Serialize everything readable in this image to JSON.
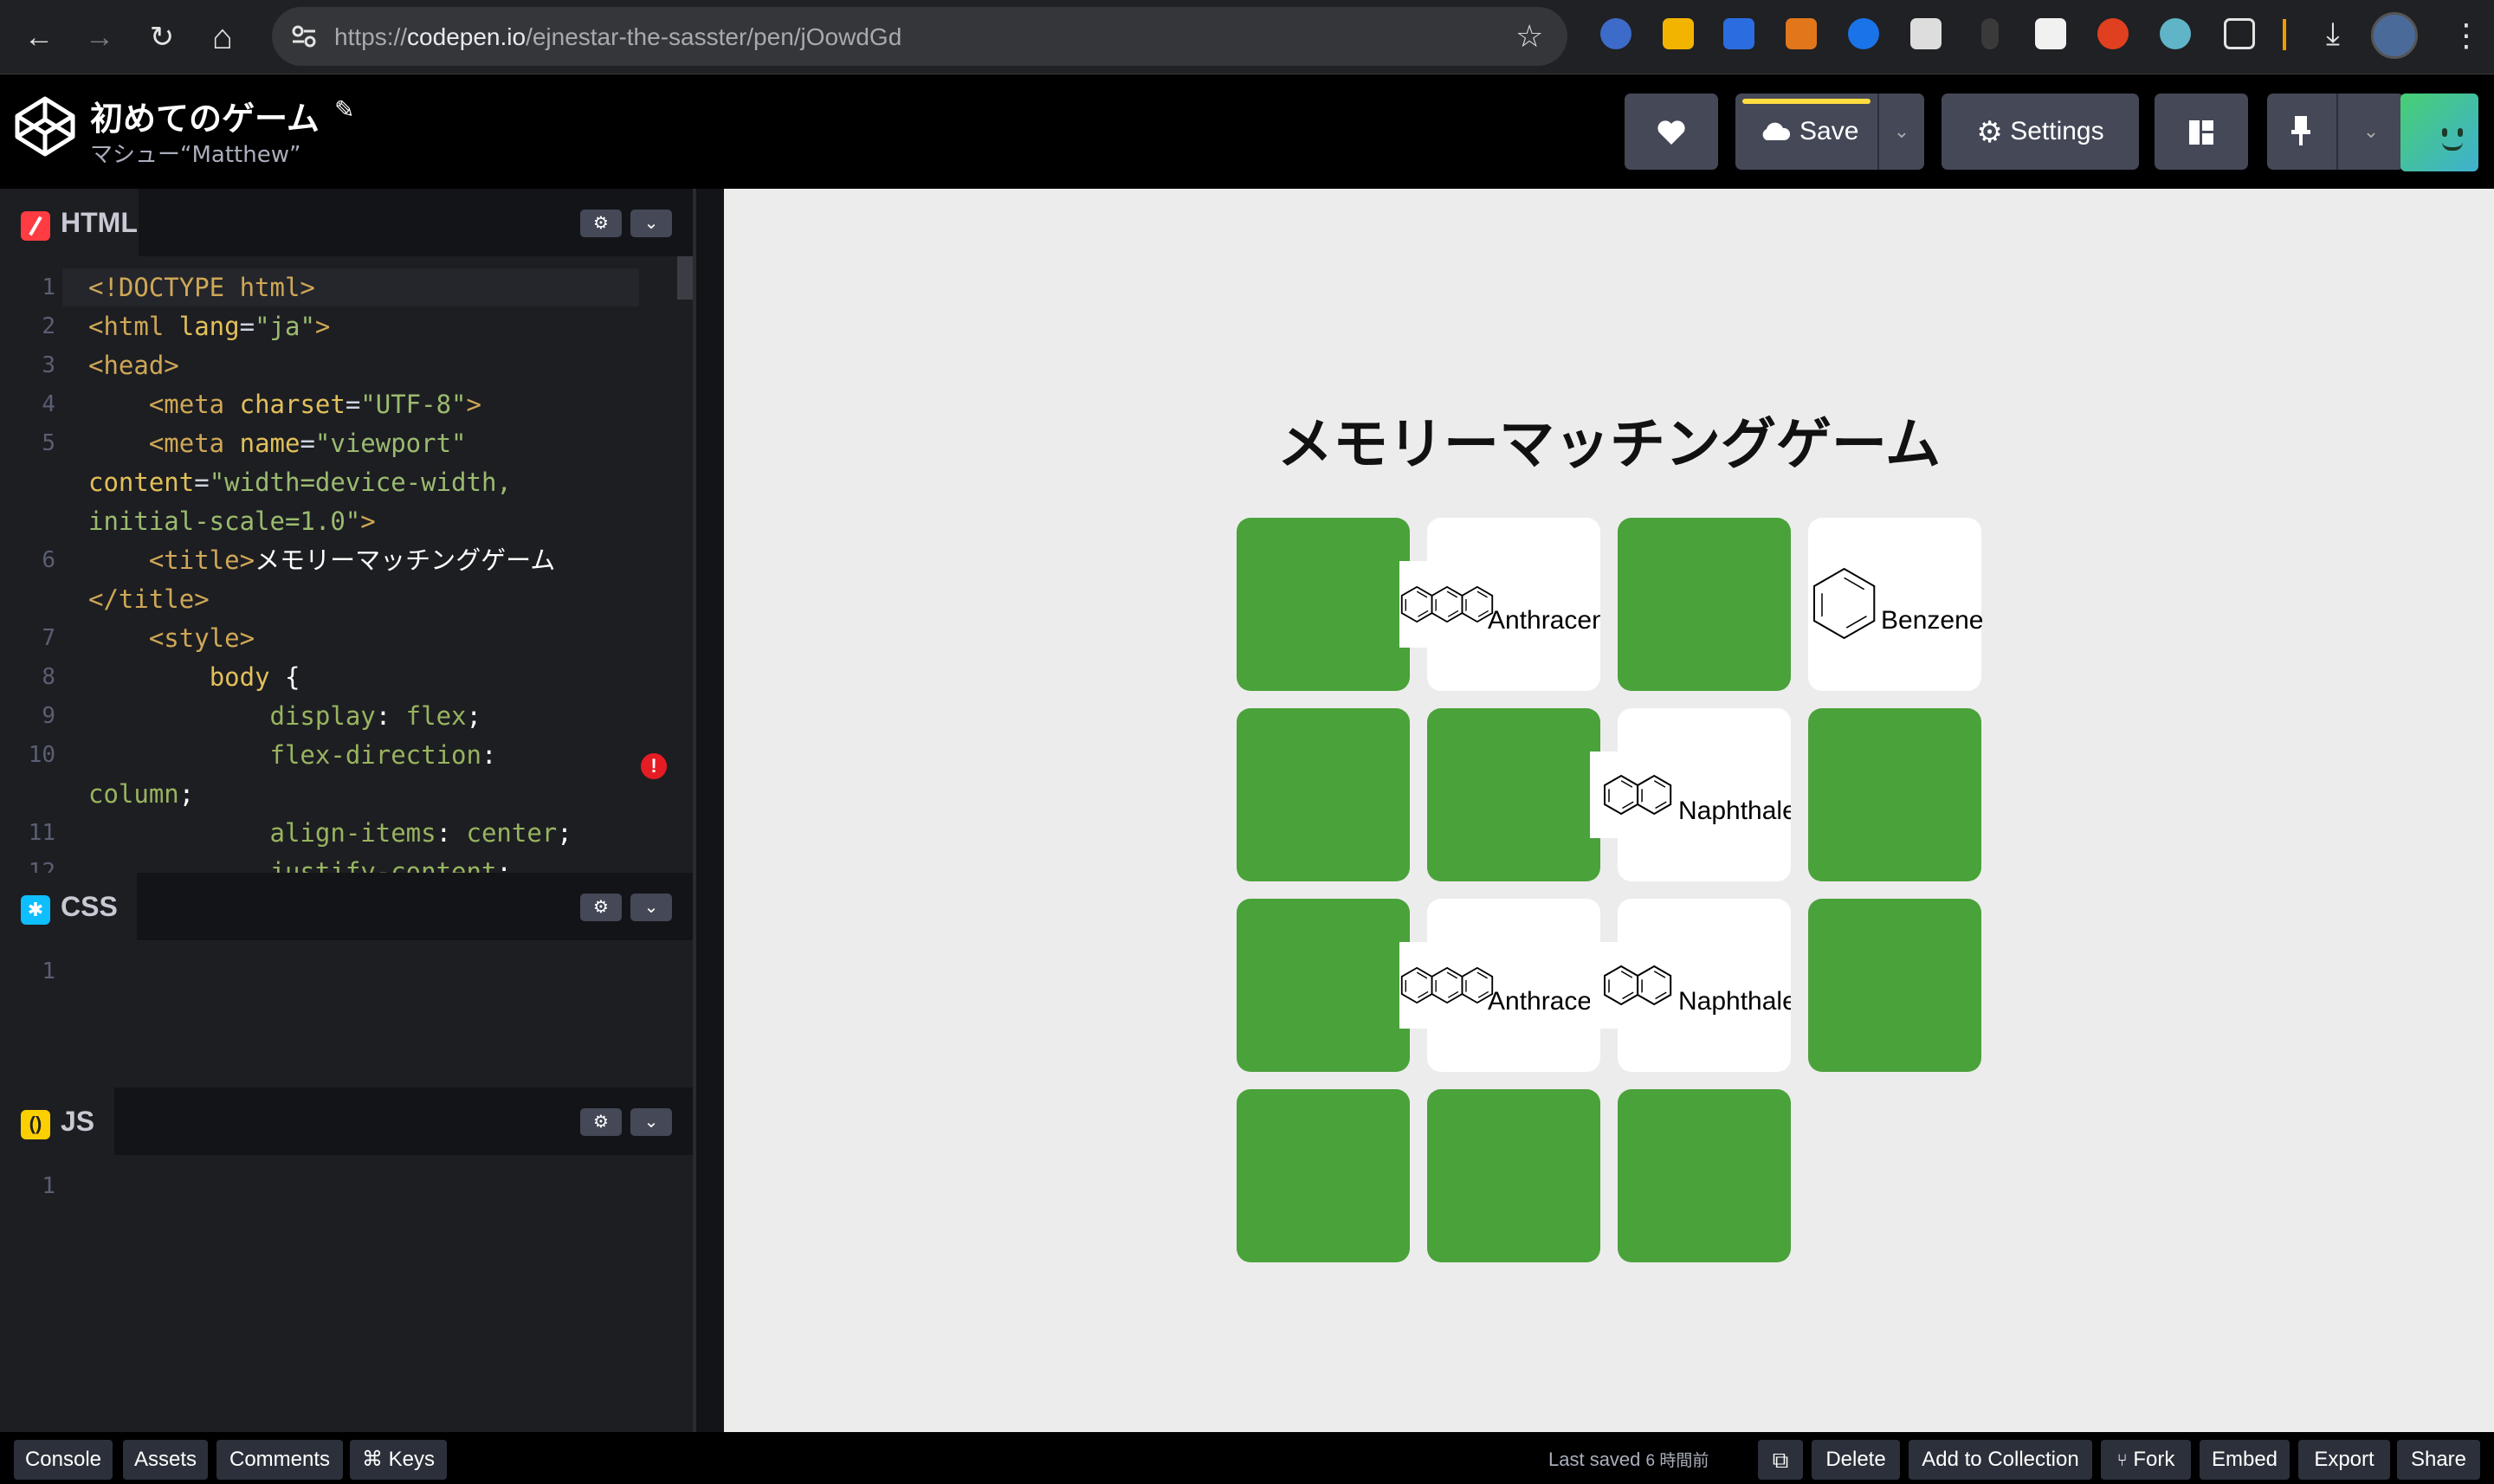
{
  "browser": {
    "url_prefix": "https://",
    "url_host": "codepen.io",
    "url_path": "/ejnestar-the-sasster/pen/jOowdGd",
    "nav": {
      "back": "←",
      "forward": "→",
      "reload": "↻",
      "home": "⌂"
    }
  },
  "header": {
    "pen_title": "初めてのゲーム",
    "author": "マシュー“Matthew”",
    "save_label": "Save",
    "settings_label": "Settings"
  },
  "editors": {
    "html": {
      "label": "HTML",
      "line_numbers": [
        "1",
        "2",
        "3",
        "4",
        "5",
        "",
        "",
        "6",
        "",
        "7",
        "8",
        "9",
        "10",
        "",
        "11",
        "12"
      ],
      "lines": [
        [
          {
            "c": "tg",
            "t": "<!DOCTYPE html>"
          }
        ],
        [
          {
            "c": "tg",
            "t": "<html "
          },
          {
            "c": "at",
            "t": "lang"
          },
          {
            "c": "pl",
            "t": "="
          },
          {
            "c": "sv",
            "t": "\"ja\""
          },
          {
            "c": "tg",
            "t": ">"
          }
        ],
        [
          {
            "c": "tg",
            "t": "<head>"
          }
        ],
        [
          {
            "c": "pl",
            "t": "    "
          },
          {
            "c": "tg",
            "t": "<meta "
          },
          {
            "c": "at",
            "t": "charset"
          },
          {
            "c": "pl",
            "t": "="
          },
          {
            "c": "sv",
            "t": "\"UTF-8\""
          },
          {
            "c": "tg",
            "t": ">"
          }
        ],
        [
          {
            "c": "pl",
            "t": "    "
          },
          {
            "c": "tg",
            "t": "<meta "
          },
          {
            "c": "at",
            "t": "name"
          },
          {
            "c": "pl",
            "t": "="
          },
          {
            "c": "sv",
            "t": "\"viewport\""
          }
        ],
        [
          {
            "c": "at",
            "t": "content"
          },
          {
            "c": "pl",
            "t": "="
          },
          {
            "c": "sv",
            "t": "\"width=device-width,"
          }
        ],
        [
          {
            "c": "sv",
            "t": "initial-scale=1.0\""
          },
          {
            "c": "tg",
            "t": ">"
          }
        ],
        [
          {
            "c": "pl",
            "t": "    "
          },
          {
            "c": "tg",
            "t": "<title>"
          },
          {
            "c": "wt",
            "t": "メモリーマッチングゲーム"
          }
        ],
        [
          {
            "c": "tg",
            "t": "</title>"
          }
        ],
        [
          {
            "c": "pl",
            "t": "    "
          },
          {
            "c": "tg",
            "t": "<style>"
          }
        ],
        [
          {
            "c": "pl",
            "t": "        "
          },
          {
            "c": "at",
            "t": "body "
          },
          {
            "c": "wt",
            "t": "{"
          }
        ],
        [
          {
            "c": "pl",
            "t": "            "
          },
          {
            "c": "pr",
            "t": "display"
          },
          {
            "c": "wt",
            "t": ": "
          },
          {
            "c": "pr",
            "t": "flex"
          },
          {
            "c": "wt",
            "t": ";"
          }
        ],
        [
          {
            "c": "pl",
            "t": "            "
          },
          {
            "c": "pr",
            "t": "flex-direction"
          },
          {
            "c": "wt",
            "t": ":"
          }
        ],
        [
          {
            "c": "pr",
            "t": "column"
          },
          {
            "c": "wt",
            "t": ";"
          }
        ],
        [
          {
            "c": "pl",
            "t": "            "
          },
          {
            "c": "pr",
            "t": "align-items"
          },
          {
            "c": "wt",
            "t": ": "
          },
          {
            "c": "pr",
            "t": "center"
          },
          {
            "c": "wt",
            "t": ";"
          }
        ],
        [
          {
            "c": "pl",
            "t": "            "
          },
          {
            "c": "pr",
            "t": "justify-content"
          },
          {
            "c": "wt",
            "t": ":"
          }
        ]
      ]
    },
    "css": {
      "label": "CSS",
      "line_number": "1"
    },
    "js": {
      "label": "JS",
      "line_number": "1"
    }
  },
  "preview": {
    "title": "メモリーマッチングゲーム",
    "cards": [
      {
        "state": "down",
        "label": "",
        "icon": ""
      },
      {
        "state": "up",
        "label": "Anthracene",
        "icon": "anthracene-icon"
      },
      {
        "state": "down",
        "label": "",
        "icon": ""
      },
      {
        "state": "up",
        "label": "Benzene",
        "icon": "benzene-icon"
      },
      {
        "state": "down",
        "label": "",
        "icon": ""
      },
      {
        "state": "down",
        "label": "",
        "icon": ""
      },
      {
        "state": "up",
        "label": "Naphthalene",
        "icon": "naphthalene-icon"
      },
      {
        "state": "down",
        "label": "",
        "icon": ""
      },
      {
        "state": "down",
        "label": "",
        "icon": ""
      },
      {
        "state": "up",
        "label": "Anthracene",
        "icon": "anthracene-icon"
      },
      {
        "state": "up",
        "label": "Naphthalene",
        "icon": "naphthalene-icon"
      },
      {
        "state": "down",
        "label": "",
        "icon": ""
      },
      {
        "state": "down",
        "label": "",
        "icon": ""
      },
      {
        "state": "down",
        "label": "",
        "icon": ""
      },
      {
        "state": "down",
        "label": "",
        "icon": ""
      }
    ],
    "card_back_color": "#4aa23a"
  },
  "footer": {
    "console": "Console",
    "assets": "Assets",
    "comments": "Comments",
    "keys": "⌘ Keys",
    "last_saved": "Last saved",
    "last_saved_time": "6 時間前",
    "delete": "Delete",
    "add_to_collection": "Add to Collection",
    "fork": "Fork",
    "embed": "Embed",
    "export": "Export",
    "share": "Share"
  }
}
